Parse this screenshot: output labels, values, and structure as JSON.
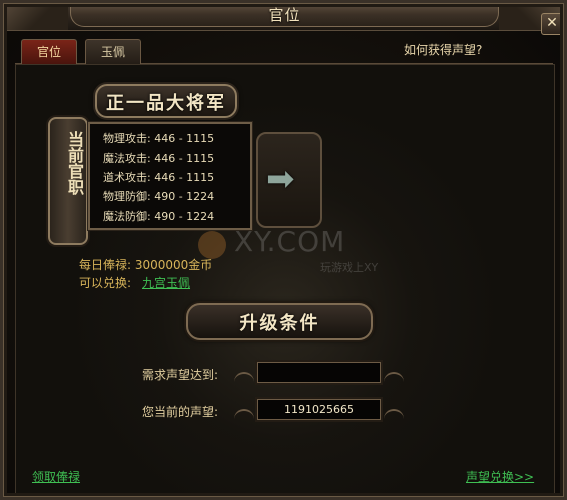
{
  "window": {
    "title": "官位",
    "close_glyph": "✕"
  },
  "tabs": [
    {
      "label": "官位",
      "active": true
    },
    {
      "label": "玉佩",
      "active": false
    }
  ],
  "help_link": "如何获得声望?",
  "rank": {
    "title": "正一品大将军",
    "badge": "当前官职",
    "stats": [
      {
        "label": "物理攻击:",
        "value": "446 - 1115"
      },
      {
        "label": "魔法攻击:",
        "value": "446 - 1115"
      },
      {
        "label": "道术攻击:",
        "value": "446 - 1115"
      },
      {
        "label": "物理防御:",
        "value": "490 - 1224"
      },
      {
        "label": "魔法防御:",
        "value": "490 - 1224"
      }
    ]
  },
  "watermark": {
    "text": "XY.COM",
    "sub": "玩游戏上XY"
  },
  "salary": {
    "label": "每日俸禄: 3000000金币"
  },
  "exchange": {
    "label": "可以兑换:",
    "item": "九宫玉佩"
  },
  "upgrade": {
    "title": "升级条件",
    "required_label": "需求声望达到:",
    "required_value": "",
    "current_label": "您当前的声望:",
    "current_value": "1191025665"
  },
  "footer": {
    "claim_salary": "领取俸禄",
    "exchange_prestige": "声望兑换>>"
  },
  "colors": {
    "gold": "#d7b45a",
    "link_green": "#3fbf53",
    "active_tab": "#7a2418"
  }
}
